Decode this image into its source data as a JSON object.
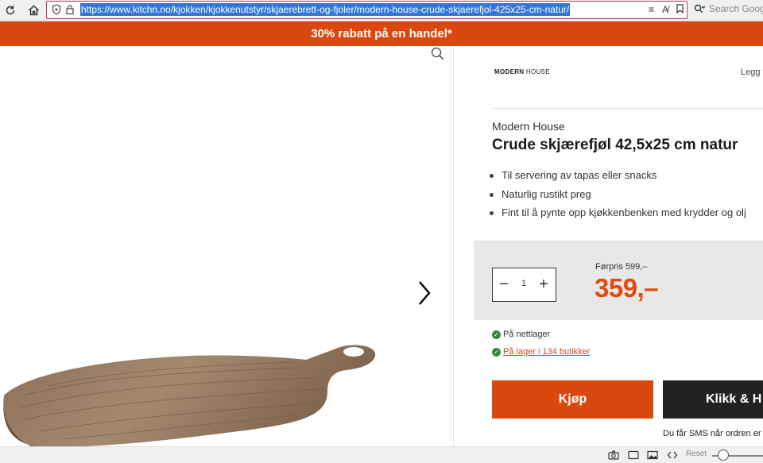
{
  "browser": {
    "url": "https://www.kitchn.no/kjokken/kjokkenutstyr/skjaerebrett-og-fjoler/modern-house-crude-skjaerefjol-425x25-cm-natur/",
    "search_placeholder": "Search Google"
  },
  "banner": {
    "text": "30% rabatt på en handel*"
  },
  "product": {
    "brand_logo_bold": "MODERN",
    "brand_logo_rest": " HOUSE",
    "legg_text": "Legg t",
    "brand": "Modern House",
    "title": "Crude skjærefjøl 42,5x25 cm natur",
    "bullets": [
      "Til servering av tapas eller snacks",
      "Naturlig rustikt preg",
      "Fint til å pynte opp kjøkkenbenken med krydder og olj"
    ],
    "quantity": "1",
    "old_price": "Førpris 599,–",
    "price": "359,–",
    "stock_online": "På nettlager",
    "stock_stores": "På lager i 134 butikker",
    "buy_label": "Kjøp",
    "click_collect_label": "Klikk & H",
    "sms_text": "Du får SMS når ordren er",
    "accent_color": "#d9480f",
    "price_color": "#e04c0f"
  },
  "statusbar": {
    "reset_label": "Reset",
    "zoom_level": 0.22
  }
}
